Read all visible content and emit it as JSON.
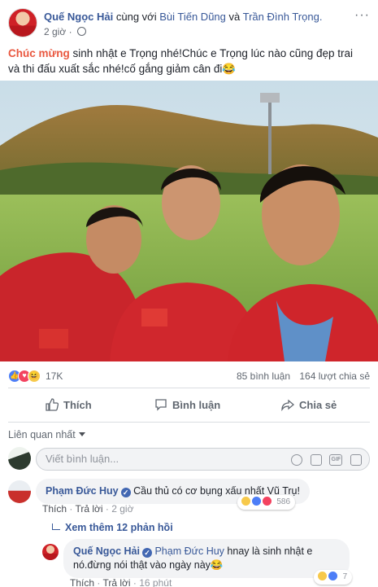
{
  "post": {
    "author": "Quế Ngọc Hải",
    "with_text": "cùng với",
    "tag1": "Bùi Tiến Dũng",
    "and_text": "và",
    "tag2": "Trần Đình Trọng.",
    "time": "2 giờ",
    "options": "···",
    "highlight": "Chúc mừng",
    "body": " sinh nhật e Trọng nhé!Chúc e Trọng lúc nào cũng đẹp trai và thi đấu xuất sắc nhé!cố gắng giảm cân đi😂"
  },
  "reactions": {
    "count": "17K",
    "comments": "85 bình luận",
    "shares": "164 lượt chia sẻ"
  },
  "actions": {
    "like": "Thích",
    "comment": "Bình luận",
    "share": "Chia sẻ"
  },
  "sort": {
    "label": "Liên quan nhất"
  },
  "comment_box": {
    "placeholder": "Viết bình luận..."
  },
  "comments": [
    {
      "author": "Phạm Đức Huy",
      "text": "Cầu thủ có cơ bụng xấu nhất Vũ Trụ!",
      "like": "Thích",
      "reply": "Trả lời",
      "time": "2 giờ",
      "reaction_count": "586"
    }
  ],
  "more_replies": "Xem thêm 12 phản hồi",
  "reply": {
    "author": "Quế Ngọc Hải",
    "mention": "Phạm Đức Huy",
    "text": " hnay là sinh nhật e nó.đừng nói thật vào ngày này😂",
    "like": "Thích",
    "reply": "Trả lời",
    "time": "16 phút",
    "reaction_count": "7"
  },
  "colors": {
    "link": "#385898",
    "highlight": "#e9573f",
    "like_blue": "#4d7ef7",
    "love_red": "#f3425f",
    "haha_yellow": "#f7c94b"
  }
}
